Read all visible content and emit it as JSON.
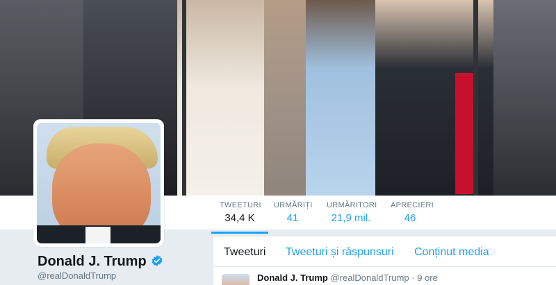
{
  "profile": {
    "name": "Donald J. Trump",
    "handle": "@realDonaldTrump",
    "verified": true
  },
  "stats": [
    {
      "label": "TWEETURI",
      "value": "34,4 K"
    },
    {
      "label": "URMĂRIȚI",
      "value": "41"
    },
    {
      "label": "URMĂRITORI",
      "value": "21,9 mil."
    },
    {
      "label": "APRECIERI",
      "value": "46"
    }
  ],
  "tabs": [
    {
      "label": "Tweeturi"
    },
    {
      "label": "Tweeturi și răspunsuri"
    },
    {
      "label": "Conținut media"
    }
  ],
  "tweet": {
    "author": "Donald J. Trump",
    "handle": "@realDonaldTrump",
    "separator": "·",
    "time": "9 ore"
  },
  "colors": {
    "accent": "#1da1f2",
    "verified": "#1da1f2",
    "text": "#14171a",
    "muted": "#657786"
  },
  "icons": {
    "verified": "verified-badge-icon"
  }
}
